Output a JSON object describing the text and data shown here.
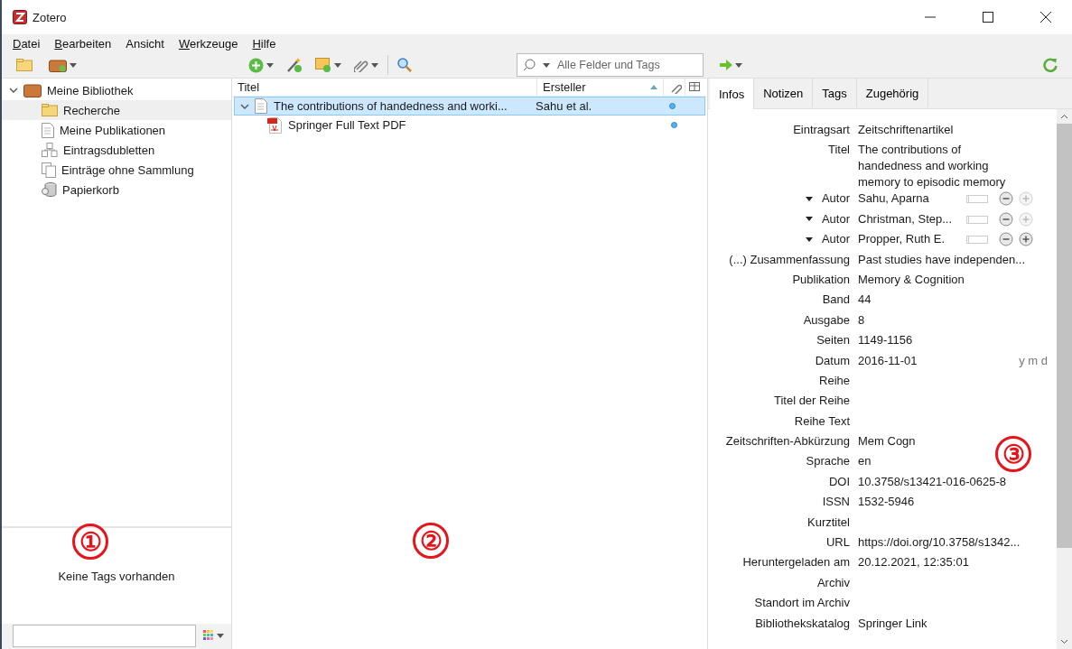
{
  "window": {
    "title": "Zotero"
  },
  "menu": [
    {
      "label": "Datei",
      "mnemonic": true
    },
    {
      "label": "Bearbeiten",
      "mnemonic": true
    },
    {
      "label": "Ansicht",
      "mnemonic": false
    },
    {
      "label": "Werkzeuge",
      "mnemonic": true
    },
    {
      "label": "Hilfe",
      "mnemonic": true
    }
  ],
  "search": {
    "placeholder": "Alle Felder und Tags"
  },
  "collections": {
    "label": "Meine Bibliothek",
    "expanded": true,
    "selected": false,
    "children": [
      {
        "label": "Recherche",
        "kind": "folder",
        "selected": true
      },
      {
        "label": "Meine Publikationen",
        "kind": "page",
        "selected": false
      },
      {
        "label": "Eintragsdubletten",
        "kind": "duplicates",
        "selected": false
      },
      {
        "label": "Einträge ohne Sammlung",
        "kind": "pages",
        "selected": false
      },
      {
        "label": "Papierkorb",
        "kind": "trash",
        "selected": false
      }
    ]
  },
  "tags": {
    "message": "Keine Tags vorhanden"
  },
  "items": {
    "columns": [
      "Titel",
      "Ersteller"
    ],
    "rows": [
      {
        "title": "The contributions of handedness and worki...",
        "creator": "Sahu et al.",
        "kind": "article",
        "expanded": true,
        "selected": true,
        "children": [
          {
            "title": "Springer Full Text PDF",
            "kind": "pdf",
            "selected": false
          }
        ]
      }
    ]
  },
  "item_tabs": [
    {
      "label": "Infos",
      "selected": true
    },
    {
      "label": "Notizen",
      "selected": false
    },
    {
      "label": "Tags",
      "selected": false
    },
    {
      "label": "Zugehörig",
      "selected": false
    }
  ],
  "fields": [
    {
      "kind": "field",
      "label": "Eintragsart",
      "value": "Zeitschriftenartikel"
    },
    {
      "kind": "field",
      "label": "Titel",
      "value": "The contributions of handedness and working memory to episodic memory"
    },
    {
      "kind": "author",
      "label": "Autor",
      "value": "Sahu, Aparna",
      "add_enabled": false
    },
    {
      "kind": "author",
      "label": "Autor",
      "value": "Christman, Step...",
      "add_enabled": false
    },
    {
      "kind": "author",
      "label": "Autor",
      "value": "Propper, Ruth E.",
      "add_enabled": true
    },
    {
      "kind": "field",
      "label": "(...) Zusammenfassung",
      "value": "Past studies have independen..."
    },
    {
      "kind": "field",
      "label": "Publikation",
      "value": "Memory & Cognition"
    },
    {
      "kind": "field",
      "label": "Band",
      "value": "44"
    },
    {
      "kind": "field",
      "label": "Ausgabe",
      "value": "8"
    },
    {
      "kind": "field",
      "label": "Seiten",
      "value": "1149-1156"
    },
    {
      "kind": "date",
      "label": "Datum",
      "value": "2016-11-01",
      "hint": "y m d"
    },
    {
      "kind": "field",
      "label": "Reihe"
    },
    {
      "kind": "field",
      "label": "Titel der Reihe"
    },
    {
      "kind": "field",
      "label": "Reihe Text"
    },
    {
      "kind": "field",
      "label": "Zeitschriften-Abkürzung",
      "value": "Mem Cogn"
    },
    {
      "kind": "field",
      "label": "Sprache",
      "value": "en"
    },
    {
      "kind": "field",
      "label": "DOI",
      "value": "10.3758/s13421-016-0625-8"
    },
    {
      "kind": "field",
      "label": "ISSN",
      "value": "1532-5946"
    },
    {
      "kind": "field",
      "label": "Kurztitel"
    },
    {
      "kind": "field",
      "label": "URL",
      "value": "https://doi.org/10.3758/s1342..."
    },
    {
      "kind": "field",
      "label": "Heruntergeladen am",
      "value": "20.12.2021, 12:35:01"
    },
    {
      "kind": "field",
      "label": "Archiv"
    },
    {
      "kind": "field",
      "label": "Standort im Archiv"
    },
    {
      "kind": "field",
      "label": "Bibliothekskatalog",
      "value": "Springer Link"
    }
  ],
  "annotations": [
    "①",
    "②",
    "③"
  ]
}
